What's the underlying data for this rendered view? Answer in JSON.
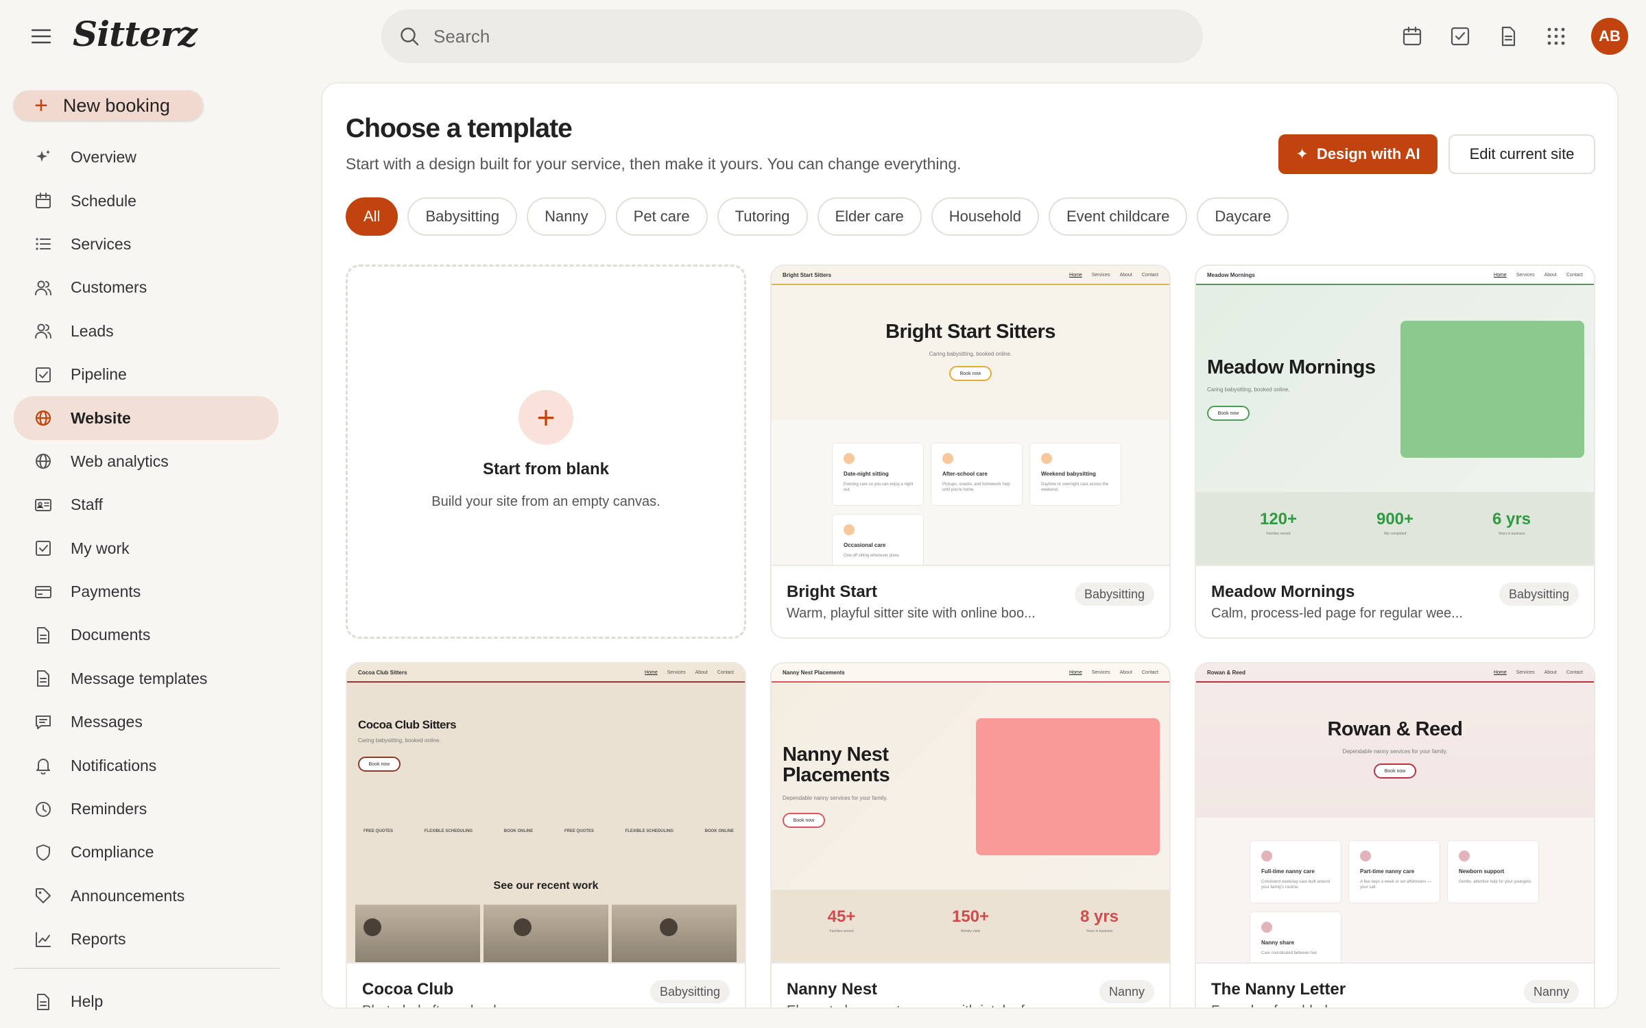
{
  "app": {
    "name": "Sitterz",
    "user_initials": "AB"
  },
  "search": {
    "placeholder": "Search"
  },
  "sidebar": {
    "new_booking": "New booking",
    "items": [
      {
        "label": "Overview",
        "icon": "sparkle-icon"
      },
      {
        "label": "Schedule",
        "icon": "calendar-icon"
      },
      {
        "label": "Services",
        "icon": "list-icon"
      },
      {
        "label": "Customers",
        "icon": "users-icon"
      },
      {
        "label": "Leads",
        "icon": "users-icon"
      },
      {
        "label": "Pipeline",
        "icon": "checkbox-icon"
      },
      {
        "label": "Website",
        "icon": "globe-icon",
        "active": true
      },
      {
        "label": "Web analytics",
        "icon": "globe-icon"
      },
      {
        "label": "Staff",
        "icon": "id-card-icon"
      },
      {
        "label": "My work",
        "icon": "checkbox-icon"
      },
      {
        "label": "Payments",
        "icon": "credit-card-icon"
      },
      {
        "label": "Documents",
        "icon": "document-icon"
      },
      {
        "label": "Message templates",
        "icon": "document-icon"
      },
      {
        "label": "Messages",
        "icon": "chat-icon"
      },
      {
        "label": "Notifications",
        "icon": "bell-icon"
      },
      {
        "label": "Reminders",
        "icon": "clock-icon"
      },
      {
        "label": "Compliance",
        "icon": "shield-icon"
      },
      {
        "label": "Announcements",
        "icon": "tag-icon"
      },
      {
        "label": "Reports",
        "icon": "chart-icon"
      }
    ],
    "help": "Help"
  },
  "main": {
    "title": "Choose a template",
    "subtitle": "Start with a design built for your service, then make it yours. You can change everything.",
    "design_ai": "Design with AI",
    "edit_site": "Edit current site",
    "filters": [
      "All",
      "Babysitting",
      "Nanny",
      "Pet care",
      "Tutoring",
      "Elder care",
      "Household",
      "Event childcare",
      "Daycare"
    ],
    "blank": {
      "title": "Start from blank",
      "desc": "Build your site from an empty canvas."
    },
    "nav_links": [
      "Home",
      "Services",
      "About",
      "Contact"
    ],
    "templates": [
      {
        "name": "Bright Start",
        "desc": "Warm, playful sitter site with online boo...",
        "tag": "Babysitting",
        "site_name": "Bright Start Sitters",
        "hero": "Bright Start Sitters",
        "tagline": "Caring babysitting, booked online.",
        "cta": "Book now",
        "features": [
          {
            "title": "Date-night sitting",
            "desc": "Evening care so you can enjoy a night out."
          },
          {
            "title": "After-school care",
            "desc": "Pickups, snacks, and homework help until you're home."
          },
          {
            "title": "Weekend babysitting",
            "desc": "Daytime or overnight care across the weekend."
          },
          {
            "title": "Occasional care",
            "desc": "One-off sitting whenever plans"
          }
        ]
      },
      {
        "name": "Meadow Mornings",
        "desc": "Calm, process-led page for regular wee...",
        "tag": "Babysitting",
        "site_name": "Meadow Mornings",
        "hero": "Meadow Mornings",
        "tagline": "Caring babysitting, booked online.",
        "cta": "Book now",
        "stats": [
          {
            "value": "120+",
            "label": "Families served"
          },
          {
            "value": "900+",
            "label": "Sits completed"
          },
          {
            "value": "6 yrs",
            "label": "Years in business"
          }
        ]
      },
      {
        "name": "Cocoa Club",
        "desc": "Photo-led after-school care on warm pa...",
        "tag": "Babysitting",
        "site_name": "Cocoa Club Sitters",
        "hero": "Cocoa Club Sitters",
        "tagline": "Caring babysitting, booked online.",
        "cta": "Book now",
        "ticker": [
          "FREE QUOTES",
          "FLEXIBLE SCHEDULING",
          "BOOK ONLINE",
          "FREE QUOTES",
          "FLEXIBLE SCHEDULING",
          "BOOK ONLINE"
        ],
        "gallery_title": "See our recent work"
      },
      {
        "name": "Nanny Nest",
        "desc": "Elegant placement agency with intake form",
        "tag": "Nanny",
        "site_name": "Nanny Nest Placements",
        "hero_l1": "Nanny Nest",
        "hero_l2": "Placements",
        "tagline": "Dependable nanny services for your family.",
        "cta": "Book now",
        "stats": [
          {
            "value": "45+",
            "label": "Families served"
          },
          {
            "value": "150+",
            "label": "Weekly visits"
          },
          {
            "value": "8 yrs",
            "label": "Years in business"
          }
        ]
      },
      {
        "name": "The Nanny Letter",
        "desc": "Formal, referral-led agency page",
        "tag": "Nanny",
        "site_name": "Rowan & Reed",
        "hero": "Rowan & Reed",
        "tagline": "Dependable nanny services for your family.",
        "cta": "Book now",
        "features": [
          {
            "title": "Full-time nanny care",
            "desc": "Consistent weekday care built around your family's routine."
          },
          {
            "title": "Part-time nanny care",
            "desc": "A few days a week or set afternoons — your call."
          },
          {
            "title": "Newborn support",
            "desc": "Gentle, attentive help for your youngest."
          },
          {
            "title": "Nanny share",
            "desc": "Care coordinated between two"
          }
        ]
      }
    ]
  },
  "colors": {
    "accent": "#c1440e",
    "accent_soft": "#f2dfd6",
    "meadow_green": "#8bc98e",
    "nest_pink": "#f79a98"
  }
}
